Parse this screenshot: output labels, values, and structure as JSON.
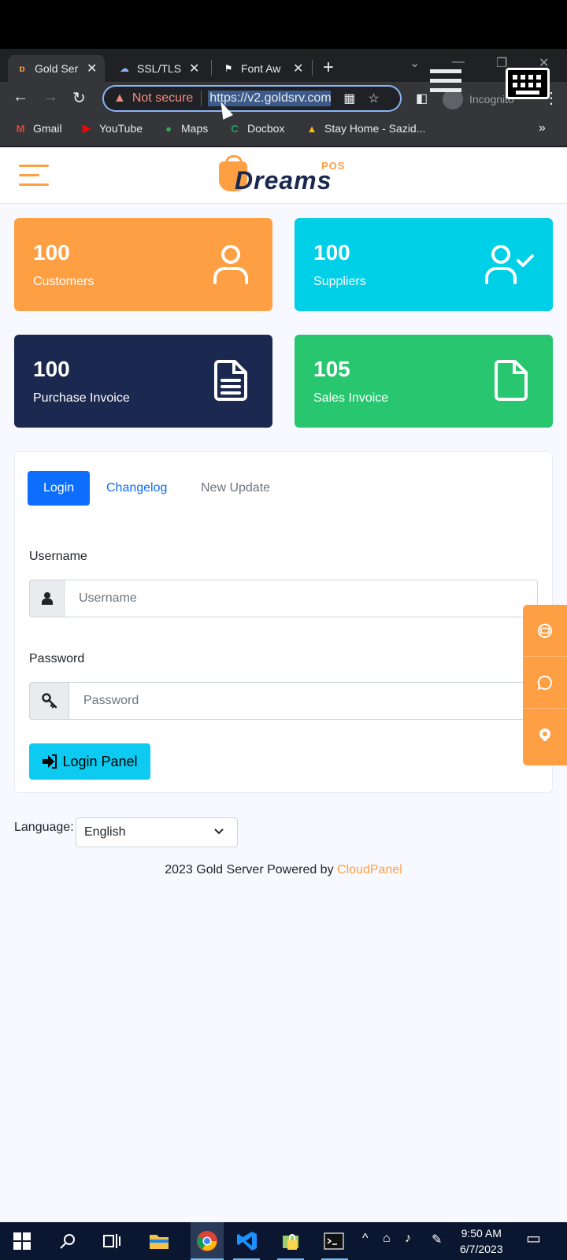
{
  "browser": {
    "tabs": [
      {
        "title": "Gold Ser",
        "active": true
      },
      {
        "title": "SSL/TLS",
        "active": false
      },
      {
        "title": "Font Aw",
        "active": false
      }
    ],
    "address": {
      "security_label": "Not secure",
      "url": "https://v2.goldsrv.com"
    },
    "profile_label": "Incognito",
    "bookmarks": [
      "Gmail",
      "YouTube",
      "Maps",
      "Docbox",
      "Stay Home - Sazid..."
    ]
  },
  "app": {
    "logo_badge": "POS",
    "logo_text": "Dreams"
  },
  "stats": [
    {
      "count": "100",
      "label": "Customers",
      "color": "#ff9f43",
      "icon": "user-icon"
    },
    {
      "count": "100",
      "label": "Suppliers",
      "color": "#00cfe8",
      "icon": "user-check-icon"
    },
    {
      "count": "100",
      "label": "Purchase Invoice",
      "color": "#1b2850",
      "icon": "file-text-icon"
    },
    {
      "count": "105",
      "label": "Sales Invoice",
      "color": "#28c76f",
      "icon": "file-icon"
    }
  ],
  "login": {
    "tabs": [
      "Login",
      "Changelog",
      "New Update"
    ],
    "username_label": "Username",
    "username_placeholder": "Username",
    "password_label": "Password",
    "password_placeholder": "Password",
    "submit_label": "Login Panel"
  },
  "language": {
    "label": "Language:",
    "selected": "English"
  },
  "footer": {
    "text": "2023 Gold Server Powered by ",
    "brand": "CloudPanel"
  },
  "taskbar": {
    "time": "9:50 AM",
    "date": "6/7/2023"
  }
}
